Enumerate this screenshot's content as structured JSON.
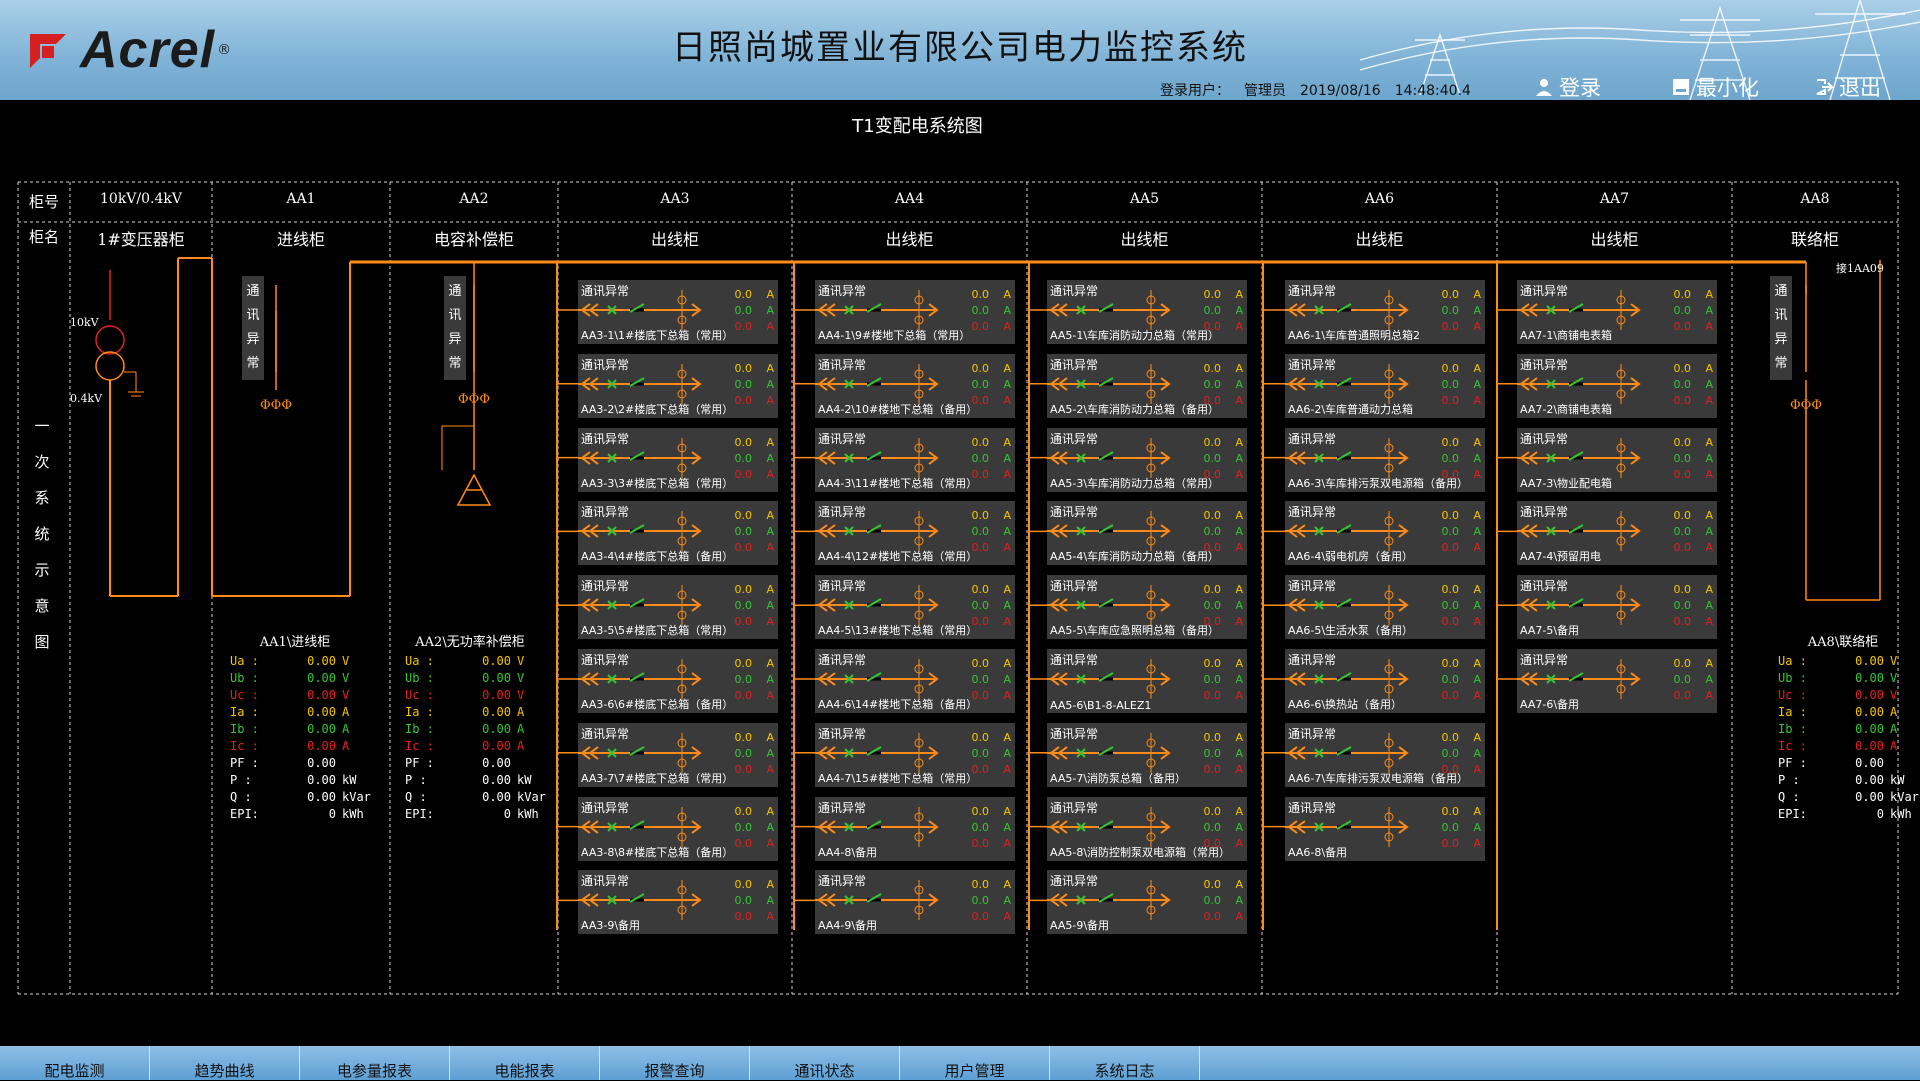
{
  "header": {
    "logo_text": "Acrel",
    "title": "日照尚城置业有限公司电力监控系统",
    "login_label": "登录用户：",
    "user": "管理员",
    "date": "2019/08/16",
    "time": "14:48:40.4",
    "btn_login": "登录",
    "btn_minimize": "最小化",
    "btn_exit": "退出"
  },
  "diagram": {
    "title": "T1变配电系统图",
    "row_no_label": "柜号",
    "row_name_label": "柜名",
    "side_label": [
      "一",
      "次",
      "系",
      "统",
      "示",
      "意",
      "图"
    ],
    "transformer_hv": "10kV",
    "transformer_lv": "0.4kV",
    "link_label": "接1AA09",
    "comm_error_vertical": [
      "通",
      "讯",
      "异",
      "常"
    ],
    "phase_symbol": "ΦΦΦ",
    "columns": [
      {
        "no": "10kV/0.4kV",
        "name": "1#变压器柜"
      },
      {
        "no": "AA1",
        "name": "进线柜"
      },
      {
        "no": "AA2",
        "name": "电容补偿柜"
      },
      {
        "no": "AA3",
        "name": "出线柜"
      },
      {
        "no": "AA4",
        "name": "出线柜"
      },
      {
        "no": "AA5",
        "name": "出线柜"
      },
      {
        "no": "AA6",
        "name": "出线柜"
      },
      {
        "no": "AA7",
        "name": "出线柜"
      },
      {
        "no": "AA8",
        "name": "联络柜"
      }
    ]
  },
  "feeder_common": {
    "status": "通讯异常",
    "v1": "0.0",
    "v2": "0.0",
    "v3": "0.0",
    "unit": "A"
  },
  "feeders": {
    "AA3": [
      "AA3-1\\1#楼底下总箱（常用）",
      "AA3-2\\2#楼底下总箱（常用）",
      "AA3-3\\3#楼底下总箱（常用）",
      "AA3-4\\4#楼底下总箱（备用）",
      "AA3-5\\5#楼底下总箱（常用）",
      "AA3-6\\6#楼底下总箱（备用）",
      "AA3-7\\7#楼底下总箱（常用）",
      "AA3-8\\8#楼底下总箱（备用）",
      "AA3-9\\备用"
    ],
    "AA4": [
      "AA4-1\\9#楼地下总箱（常用）",
      "AA4-2\\10#楼地下总箱（备用）",
      "AA4-3\\11#楼地下总箱（常用）",
      "AA4-4\\12#楼地下总箱（常用）",
      "AA4-5\\13#楼地下总箱（常用）",
      "AA4-6\\14#楼地下总箱（备用）",
      "AA4-7\\15#楼地下总箱（常用）",
      "AA4-8\\备用",
      "AA4-9\\备用"
    ],
    "AA5": [
      "AA5-1\\车库消防动力总箱（常用）",
      "AA5-2\\车库消防动力总箱（备用）",
      "AA5-3\\车库消防动力总箱（常用）",
      "AA5-4\\车库消防动力总箱（备用）",
      "AA5-5\\车库应急照明总箱（备用）",
      "AA5-6\\B1-8-ALEZ1",
      "AA5-7\\消防泵总箱（备用）",
      "AA5-8\\消防控制泵双电源箱（常用）",
      "AA5-9\\备用"
    ],
    "AA6": [
      "AA6-1\\车库普通照明总箱2",
      "AA6-2\\车库普通动力总箱",
      "AA6-3\\车库排污泵双电源箱（备用）",
      "AA6-4\\弱电机房（备用）",
      "AA6-5\\生活水泵（备用）",
      "AA6-6\\换热站（备用）",
      "AA6-7\\车库排污泵双电源箱（备用）",
      "AA6-8\\备用"
    ],
    "AA7": [
      "AA7-1\\商铺电表箱",
      "AA7-2\\商铺电表箱",
      "AA7-3\\物业配电箱",
      "AA7-4\\预留用电",
      "AA7-5\\备用",
      "AA7-6\\备用"
    ]
  },
  "meters": [
    {
      "title": "AA1\\进线柜",
      "rows": [
        [
          "Ua :",
          "0.00",
          "V"
        ],
        [
          "Ub :",
          "0.00",
          "V"
        ],
        [
          "Uc :",
          "0.00",
          "V"
        ],
        [
          "Ia :",
          "0.00",
          "A"
        ],
        [
          "Ib :",
          "0.00",
          "A"
        ],
        [
          "Ic :",
          "0.00",
          "A"
        ],
        [
          "PF :",
          "0.00",
          ""
        ],
        [
          "P  :",
          "0.00",
          "kW"
        ],
        [
          "Q  :",
          "0.00",
          "kVar"
        ],
        [
          "EPI:",
          "0",
          "kWh"
        ]
      ]
    },
    {
      "title": "AA2\\无功率补偿柜",
      "rows": [
        [
          "Ua :",
          "0.00",
          "V"
        ],
        [
          "Ub :",
          "0.00",
          "V"
        ],
        [
          "Uc :",
          "0.00",
          "V"
        ],
        [
          "Ia :",
          "0.00",
          "A"
        ],
        [
          "Ib :",
          "0.00",
          "A"
        ],
        [
          "Ic :",
          "0.00",
          "A"
        ],
        [
          "PF :",
          "0.00",
          ""
        ],
        [
          "P  :",
          "0.00",
          "kW"
        ],
        [
          "Q  :",
          "0.00",
          "kVar"
        ],
        [
          "EPI:",
          "0",
          "kWh"
        ]
      ]
    },
    {
      "title": "AA8\\联络柜",
      "rows": [
        [
          "Ua :",
          "0.00",
          "V"
        ],
        [
          "Ub :",
          "0.00",
          "V"
        ],
        [
          "Uc :",
          "0.00",
          "V"
        ],
        [
          "Ia :",
          "0.00",
          "A"
        ],
        [
          "Ib :",
          "0.00",
          "A"
        ],
        [
          "Ic :",
          "0.00",
          "A"
        ],
        [
          "PF :",
          "0.00",
          ""
        ],
        [
          "P  :",
          "0.00",
          "kW"
        ],
        [
          "Q  :",
          "0.00",
          "kVar"
        ],
        [
          "EPI:",
          "0",
          "kWh"
        ]
      ]
    }
  ],
  "meter_colors": [
    "#f5c400",
    "#35c435",
    "#e02020",
    "#f5c400",
    "#35c435",
    "#e02020",
    "#ffffff",
    "#ffffff",
    "#ffffff",
    "#ffffff"
  ],
  "colors": {
    "bus": "#ff8c1a",
    "accent_yellow": "#f5c400",
    "accent_green": "#35c435",
    "accent_red": "#e02020"
  },
  "tabs": [
    "配电监测",
    "趋势曲线",
    "电参量报表",
    "电能报表",
    "报警查询",
    "通讯状态",
    "用户管理",
    "系统日志"
  ]
}
